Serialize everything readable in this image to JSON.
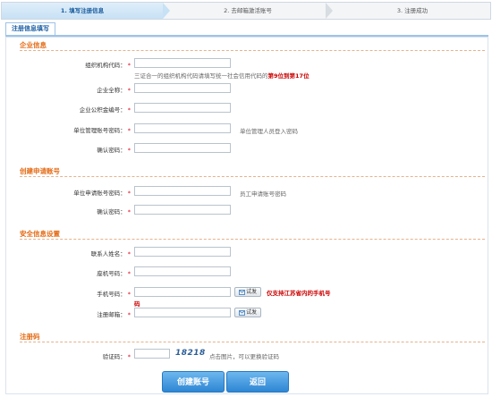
{
  "steps": [
    {
      "label": "1. 填写注册信息"
    },
    {
      "label": "2. 去邮箱激活账号"
    },
    {
      "label": "3. 注册成功"
    }
  ],
  "tab_label": "注册信息填写",
  "sections": {
    "company": "企业信息",
    "account": "创建申请账号",
    "security": "安全信息设置",
    "code": "注册码"
  },
  "fields": {
    "org_code": {
      "label": "组织机构代码：",
      "value": ""
    },
    "company_name": {
      "label": "企业全称：",
      "value": ""
    },
    "fund_no": {
      "label": "企业公积金编号：",
      "value": ""
    },
    "unit_admin_pwd": {
      "label": "单位管理账号密码：",
      "value": ""
    },
    "confirm_pwd1": {
      "label": "确认密码：",
      "value": ""
    },
    "unit_apply_pwd": {
      "label": "单位申请账号密码：",
      "value": ""
    },
    "confirm_pwd2": {
      "label": "确认密码：",
      "value": ""
    },
    "contact_name": {
      "label": "联系人姓名：",
      "value": ""
    },
    "landline": {
      "label": "座机号码：",
      "value": ""
    },
    "mobile": {
      "label": "手机号码：",
      "value": ""
    },
    "email": {
      "label": "注册邮箱：",
      "value": ""
    },
    "captcha": {
      "label": "验证码：",
      "value": ""
    }
  },
  "required_mark": "*",
  "hints": {
    "org_code_pre": "三证合一的组织机构代码请填写统一社会信用代码的",
    "org_code_emph": "第9位到第17位",
    "unit_admin": "单位管理人员登入密码",
    "unit_apply": "员工申请账号密码",
    "mobile_warn_1": "仅支持江苏省内的手机号",
    "mobile_warn_2": "码",
    "captcha_code": "18218",
    "captcha_hint": "点击图片，可以更换验证码"
  },
  "buttons": {
    "test": "试发",
    "create": "创建账号",
    "back": "返回"
  },
  "colors": {
    "section_orange": "#e46a13",
    "accent_blue": "#2e86d3",
    "required_red": "#e2001a"
  }
}
